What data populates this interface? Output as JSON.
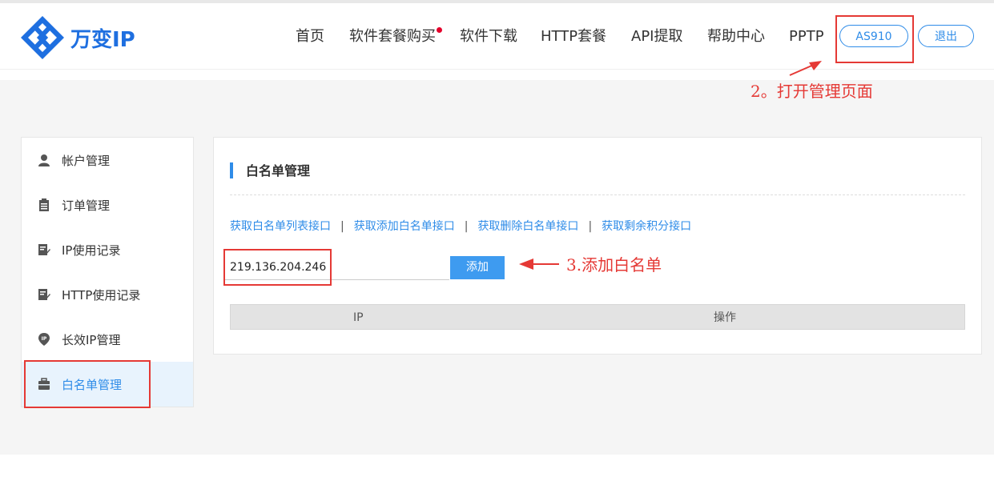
{
  "brand": {
    "name": "万变IP"
  },
  "nav": {
    "items": [
      "首页",
      "软件套餐购买",
      "软件下载",
      "HTTP套餐",
      "API提取",
      "帮助中心",
      "PPTP"
    ],
    "username": "AS910",
    "logout_label": "退出"
  },
  "annotations": {
    "step2": "2。打开管理页面",
    "step3": "3.添加白名单"
  },
  "sidebar": {
    "items": [
      {
        "label": "帐户管理",
        "icon": "user-icon"
      },
      {
        "label": "订单管理",
        "icon": "clipboard-icon"
      },
      {
        "label": "IP使用记录",
        "icon": "edit-icon"
      },
      {
        "label": "HTTP使用记录",
        "icon": "edit-icon"
      },
      {
        "label": "长效IP管理",
        "icon": "ip-pin-icon"
      },
      {
        "label": "白名单管理",
        "icon": "briefcase-icon",
        "active": true
      }
    ]
  },
  "panel": {
    "title": "白名单管理",
    "api_links": [
      "获取白名单列表接口",
      "获取添加白名单接口",
      "获取删除白名单接口",
      "获取剩余积分接口"
    ],
    "ip_input_value": "219.136.204.246",
    "add_button_label": "添加",
    "table": {
      "columns": [
        "IP",
        "操作"
      ],
      "rows": []
    }
  },
  "colors": {
    "accent": "#2f8ce8",
    "annotation": "#e53935",
    "logo": "#1e6fe0"
  }
}
